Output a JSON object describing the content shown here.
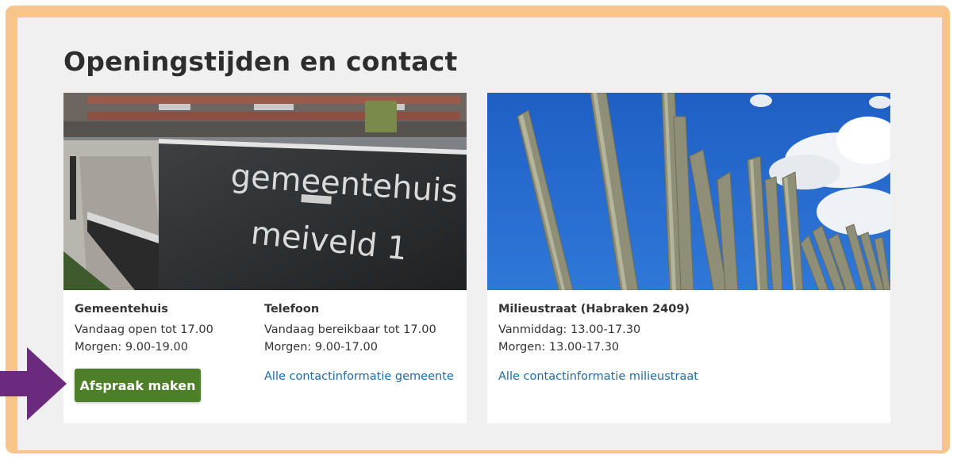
{
  "title": "Openingstijden en contact",
  "cards": [
    {
      "photo": "gemeentehuis-photo",
      "photo_sign_line1": "gemeentehuis",
      "photo_sign_line2": "meiveld 1",
      "columns": [
        {
          "title": "Gemeentehuis",
          "lines": [
            "Vandaag open tot 17.00",
            "Morgen: 9.00-19.00"
          ],
          "button_label": "Afspraak maken"
        },
        {
          "title": "Telefoon",
          "lines": [
            "Vandaag bereikbaar tot 17.00",
            "Morgen: 9.00-17.00"
          ],
          "link_label": "Alle contactinformatie gemeente"
        }
      ]
    },
    {
      "photo": "milieustraat-poles-photo",
      "columns": [
        {
          "title": "Milieustraat (Habraken 2409)",
          "lines": [
            "Vanmiddag: 13.00-17.30",
            "Morgen: 13.00-17.30"
          ],
          "link_label": "Alle contactinformatie milieustraat"
        }
      ]
    }
  ],
  "colors": {
    "frame": "#f7c48c",
    "panel": "#f0f0f0",
    "button": "#4d7f28",
    "link": "#1f6aa5",
    "arrow": "#6b2a7e"
  },
  "annotation_icon": "purple-arrow-icon"
}
